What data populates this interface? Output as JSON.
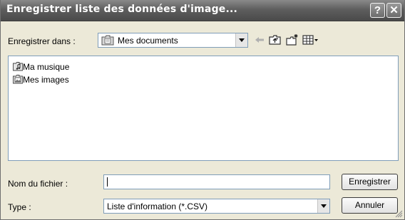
{
  "window": {
    "title": "Enregistrer liste des données d'image...",
    "help_label": "?",
    "close_label": "✕"
  },
  "lookin": {
    "label": "Enregistrer dans :",
    "value": "Mes documents"
  },
  "toolbar": {
    "icons": [
      "back-icon",
      "up-folder-icon",
      "new-folder-icon",
      "view-menu-icon"
    ]
  },
  "filelist": {
    "items": [
      {
        "label": "Ma musique",
        "icon": "music-folder-icon"
      },
      {
        "label": "Mes images",
        "icon": "pictures-folder-icon"
      }
    ]
  },
  "filename": {
    "label": "Nom du fichier :",
    "value": ""
  },
  "type": {
    "label": "Type :",
    "value": "Liste d'information (*.CSV)"
  },
  "buttons": {
    "save_label": "Enregistrer",
    "cancel_label": "Annuler"
  }
}
